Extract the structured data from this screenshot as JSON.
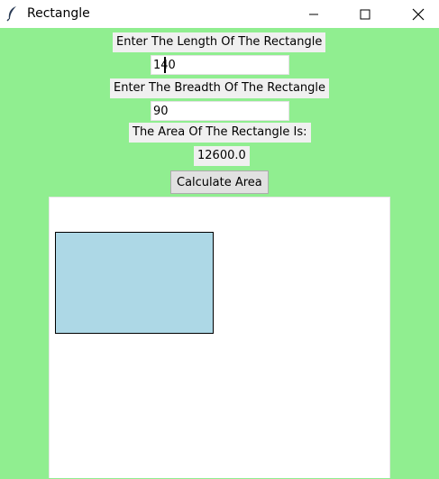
{
  "window": {
    "title": "Rectangle",
    "icon": "feather-icon"
  },
  "form": {
    "length_label": "Enter The Length Of The Rectangle",
    "length_value": "140",
    "breadth_label": "Enter The Breadth Of The Rectangle",
    "breadth_value": "90",
    "area_label": "The Area Of The Rectangle Is:",
    "area_value": "12600.0",
    "calculate_label": "Calculate Area"
  },
  "canvas": {
    "rect_fill": "#add8e6",
    "rect_outline": "#000000",
    "background": "#ffffff"
  },
  "colors": {
    "window_bg": "#90ee90"
  }
}
